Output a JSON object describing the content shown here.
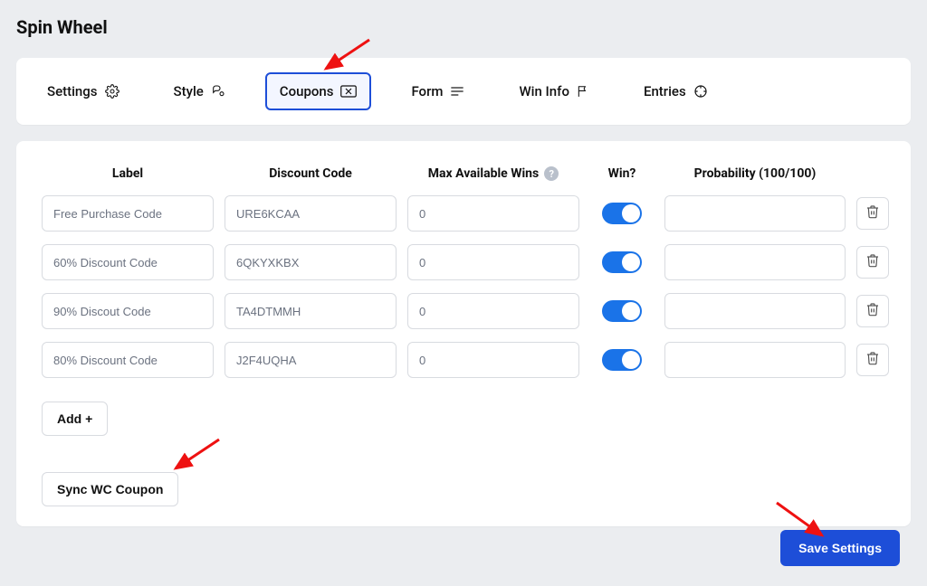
{
  "page": {
    "title": "Spin Wheel"
  },
  "tabs": {
    "settings": "Settings",
    "style": "Style",
    "coupons": "Coupons",
    "form": "Form",
    "wininfo": "Win Info",
    "entries": "Entries"
  },
  "headers": {
    "label": "Label",
    "discount_code": "Discount Code",
    "max_wins": "Max Available Wins",
    "win": "Win?",
    "probability": "Probability (100/100)"
  },
  "rows": [
    {
      "label": "Free Purchase Code",
      "code": "URE6KCAA",
      "max": "0",
      "win": true,
      "prob": ""
    },
    {
      "label": "60% Discount Code",
      "code": "6QKYXKBX",
      "max": "0",
      "win": true,
      "prob": ""
    },
    {
      "label": "90% Discout Code",
      "code": "TA4DTMMH",
      "max": "0",
      "win": true,
      "prob": ""
    },
    {
      "label": "80% Discount Code",
      "code": "J2F4UQHA",
      "max": "0",
      "win": true,
      "prob": ""
    }
  ],
  "buttons": {
    "add": "Add +",
    "sync": "Sync WC Coupon",
    "save": "Save Settings"
  }
}
